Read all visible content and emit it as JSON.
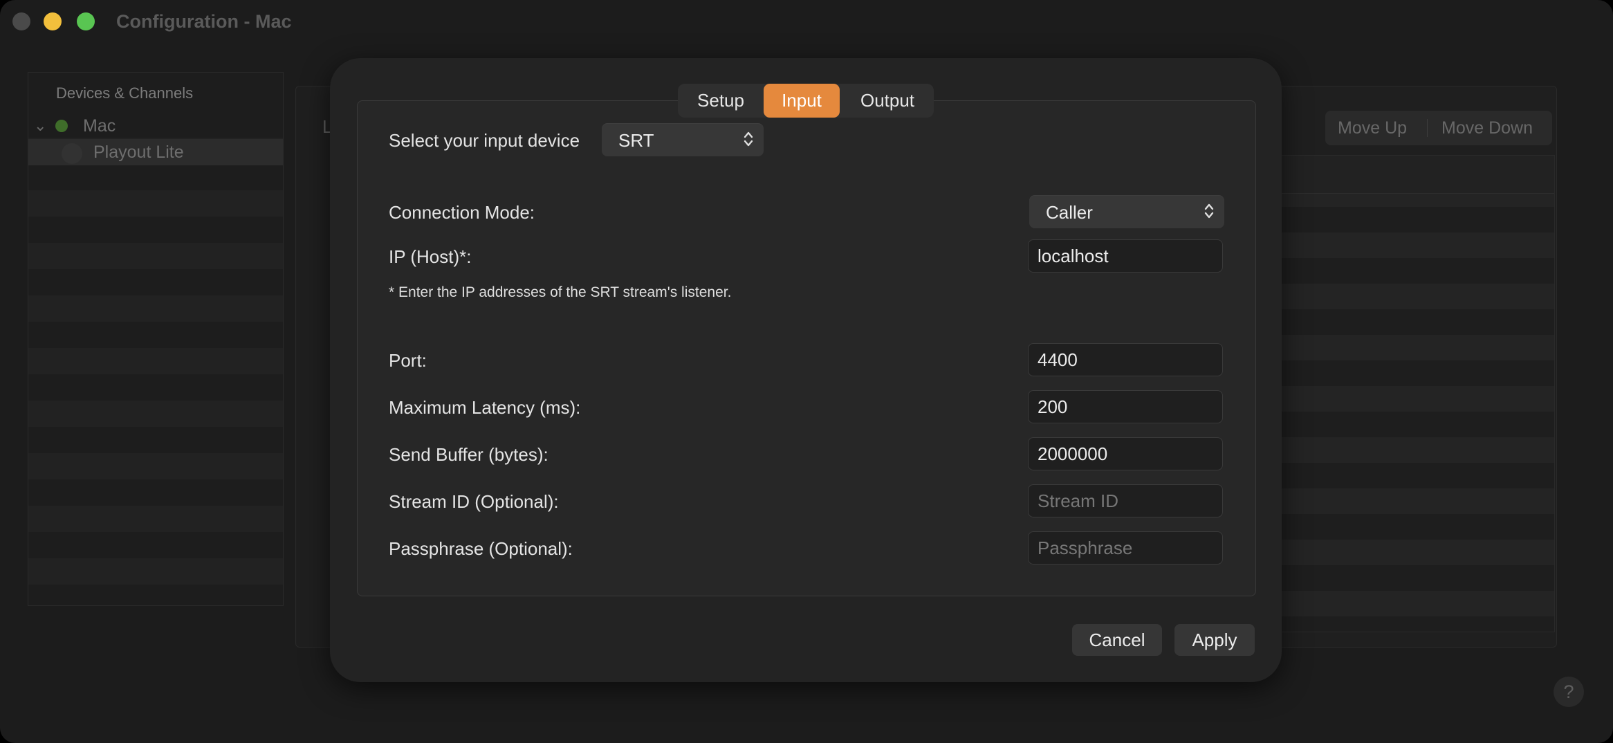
{
  "window": {
    "title": "Configuration - Mac"
  },
  "sidebar": {
    "header": "Devices & Channels",
    "items": [
      {
        "label": "Mac",
        "status": "green"
      },
      {
        "label": "Playout Lite"
      }
    ]
  },
  "main": {
    "partial_label": "L",
    "move_up": "Move Up",
    "move_down": "Move Down",
    "help": "?"
  },
  "dialog": {
    "tabs": [
      {
        "label": "Setup",
        "selected": false
      },
      {
        "label": "Input",
        "selected": true
      },
      {
        "label": "Output",
        "selected": false
      }
    ],
    "input_device": {
      "label": "Select your input device",
      "value": "SRT"
    },
    "connection_mode": {
      "label": "Connection Mode:",
      "value": "Caller"
    },
    "ip_host": {
      "label": "IP (Host)*:",
      "value": "localhost"
    },
    "note": "* Enter the IP addresses of the SRT stream's listener.",
    "port": {
      "label": "Port:",
      "value": "4400"
    },
    "max_latency": {
      "label": "Maximum Latency (ms):",
      "value": "200"
    },
    "send_buffer": {
      "label": "Send Buffer (bytes):",
      "value": "2000000"
    },
    "stream_id": {
      "label": "Stream ID (Optional):",
      "value": "",
      "placeholder": "Stream ID"
    },
    "passphrase": {
      "label": "Passphrase (Optional):",
      "value": "",
      "placeholder": "Passphrase"
    },
    "cancel": "Cancel",
    "apply": "Apply"
  },
  "colors": {
    "accent": "#e5893d",
    "window_bg": "#1c1c1c",
    "sheet_bg": "#232323"
  }
}
